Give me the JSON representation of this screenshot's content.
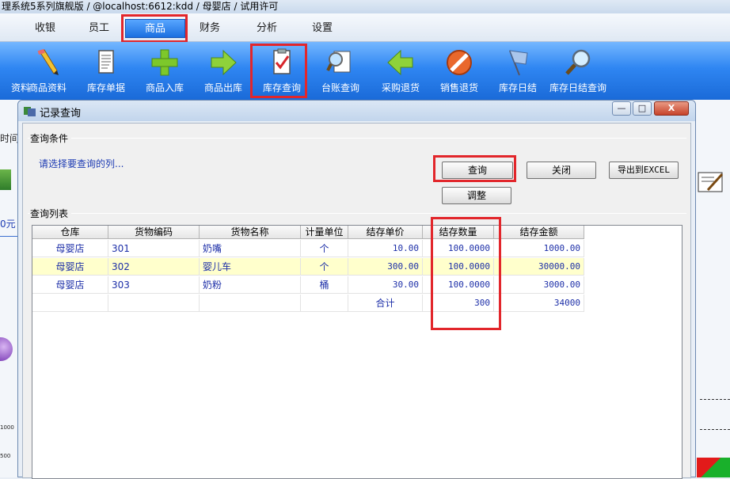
{
  "app": {
    "title": "理系统5系列旗舰版 / @localhost:6612:kdd / 母婴店 / 试用许可"
  },
  "menu": [
    {
      "label": "收银"
    },
    {
      "label": "员工"
    },
    {
      "label": "商品"
    },
    {
      "label": "财务"
    },
    {
      "label": "分析"
    },
    {
      "label": "设置"
    }
  ],
  "toolbar": [
    {
      "label": "资料",
      "icon": "partial-icon"
    },
    {
      "label": "商品资料",
      "icon": "pencil-icon"
    },
    {
      "label": "库存单据",
      "icon": "document-icon"
    },
    {
      "label": "商品入库",
      "icon": "plus-icon"
    },
    {
      "label": "商品出库",
      "icon": "arrow-right-icon"
    },
    {
      "label": "库存查询",
      "icon": "checklist-icon"
    },
    {
      "label": "台账查询",
      "icon": "ledger-search-icon"
    },
    {
      "label": "采购退货",
      "icon": "arrow-left-icon"
    },
    {
      "label": "销售退货",
      "icon": "no-entry-icon"
    },
    {
      "label": "库存日结",
      "icon": "flag-icon"
    },
    {
      "label": "库存日结查询",
      "icon": "magnifier-icon"
    }
  ],
  "background": {
    "left_text_1": "时间",
    "left_text_2": "0元",
    "axis_1000": "1000",
    "axis_500": "500"
  },
  "dialog": {
    "title": "记录查询",
    "buttons": {
      "minimize": "—",
      "maximize": "□",
      "close": "X"
    },
    "conditions_label": "查询条件",
    "hint": "请选择要查询的列...",
    "query_button": "查询",
    "close_button": "关闭",
    "export_button": "导出到EXCEL",
    "adjust_button": "调整",
    "list_label": "查询列表"
  },
  "table": {
    "columns": [
      "仓库",
      "货物编码",
      "货物名称",
      "计量单位",
      "结存单价",
      "结存数量",
      "结存金额"
    ],
    "rows": [
      [
        "母婴店",
        "301",
        "奶嘴",
        "个",
        "10.00",
        "100.0000",
        "1000.00"
      ],
      [
        "母婴店",
        "302",
        "婴儿车",
        "个",
        "300.00",
        "100.0000",
        "30000.00"
      ],
      [
        "母婴店",
        "303",
        "奶粉",
        "桶",
        "30.00",
        "100.0000",
        "3000.00"
      ]
    ],
    "total": {
      "label": "合计",
      "quantity": "300",
      "amount": "34000"
    },
    "highlight_row_index": 1
  },
  "colors": {
    "toolbar_blue": "#2f86f2",
    "highlight_row": "#ffffcc",
    "annotation_red": "#e2262b",
    "cell_text": "#1d2fa8"
  }
}
